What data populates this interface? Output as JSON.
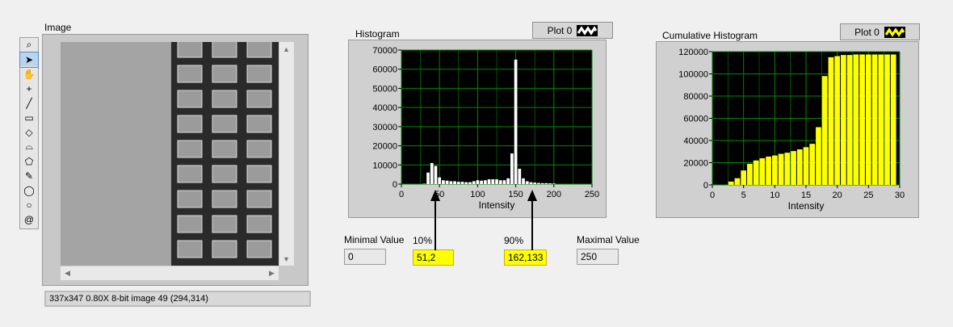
{
  "image_panel": {
    "label": "Image",
    "status_text": "337x347 0.80X 8-bit image 49     (294,314)"
  },
  "toolbar": {
    "tools": [
      "zoom-icon",
      "pointer-icon",
      "pan-icon",
      "crosshair-icon",
      "line-icon",
      "rectangle-icon",
      "rotated-rectangle-icon",
      "annulus-icon",
      "polygon-icon",
      "freehand-icon",
      "oval-icon",
      "circle-icon",
      "spiral-icon"
    ]
  },
  "histogram": {
    "title": "Histogram",
    "plot_legend": "Plot 0",
    "colors": {
      "background": "#000000",
      "grid": "#008800",
      "bars": "#ffffff"
    }
  },
  "cumulative_histogram": {
    "title": "Cumulative Histogram",
    "plot_legend": "Plot 0",
    "colors": {
      "background": "#000000",
      "grid": "#008800",
      "bars": "#ffff00"
    }
  },
  "indicators": {
    "min_label": "Minimal Value",
    "min_value": "0",
    "p10_label": "10%",
    "p10_value": "51,2",
    "p90_label": "90%",
    "p90_value": "162,133",
    "max_label": "Maximal Value",
    "max_value": "250"
  },
  "chart_data": [
    {
      "type": "bar",
      "title": "Histogram",
      "xlabel": "Intensity",
      "ylabel": "",
      "xlim": [
        0,
        250
      ],
      "ylim": [
        0,
        70000
      ],
      "xticks": [
        0,
        50,
        100,
        150,
        200,
        250
      ],
      "xtick_labels": [
        "0",
        "50",
        "100",
        "150",
        "200",
        "250"
      ],
      "yticks": [
        0,
        10000,
        20000,
        30000,
        40000,
        50000,
        60000,
        70000
      ],
      "ytick_labels": [
        "0",
        "10000",
        "20000",
        "30000",
        "40000",
        "50000",
        "60000",
        "70000"
      ],
      "x": [
        30,
        35,
        40,
        45,
        50,
        55,
        60,
        65,
        70,
        75,
        80,
        85,
        90,
        95,
        100,
        105,
        110,
        115,
        120,
        125,
        130,
        135,
        140,
        145,
        150,
        155,
        160,
        165,
        170,
        175,
        180,
        185,
        190,
        195,
        200
      ],
      "values": [
        200,
        6000,
        11000,
        9500,
        3500,
        2000,
        1800,
        1500,
        1500,
        1200,
        1200,
        1000,
        1000,
        1500,
        2000,
        1800,
        2000,
        2500,
        2500,
        2500,
        2000,
        2000,
        3000,
        16000,
        65000,
        8000,
        3000,
        1500,
        1000,
        800,
        600,
        500,
        500,
        400,
        300
      ],
      "grid": true
    },
    {
      "type": "bar",
      "title": "Cumulative Histogram",
      "xlabel": "Intensity",
      "ylabel": "",
      "xlim": [
        0,
        30
      ],
      "ylim": [
        0,
        120000
      ],
      "xticks": [
        0,
        5,
        10,
        15,
        20,
        25,
        30
      ],
      "xtick_labels": [
        "0",
        "5",
        "10",
        "15",
        "20",
        "25",
        "30"
      ],
      "yticks": [
        0,
        20000,
        40000,
        60000,
        80000,
        100000,
        120000
      ],
      "ytick_labels": [
        "0",
        "20000",
        "40000",
        "60000",
        "80000",
        "100000",
        "120000"
      ],
      "x": [
        3,
        4,
        5,
        6,
        7,
        8,
        9,
        10,
        11,
        12,
        13,
        14,
        15,
        16,
        17,
        18,
        19,
        20,
        21,
        22,
        23,
        24,
        25,
        26,
        27,
        28,
        29
      ],
      "values": [
        3000,
        6000,
        13000,
        19000,
        22000,
        24000,
        25500,
        26500,
        28000,
        29000,
        30500,
        32000,
        34000,
        37000,
        52000,
        98000,
        115000,
        116000,
        117000,
        117000,
        117500,
        117500,
        117500,
        117500,
        117500,
        117500,
        117500
      ],
      "grid": true
    }
  ]
}
